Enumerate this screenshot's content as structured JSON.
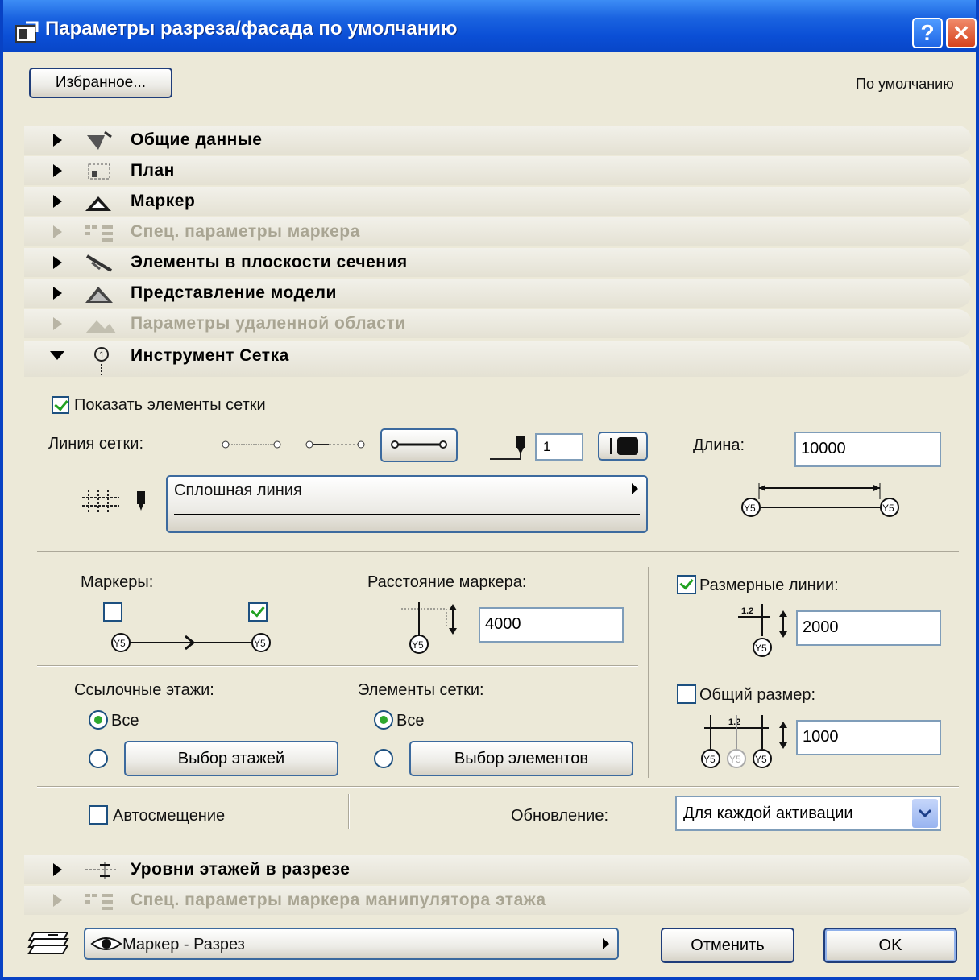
{
  "window": {
    "title": "Параметры разреза/фасада по умолчанию",
    "help_button": "?",
    "close_button": "✕"
  },
  "header": {
    "favorites_label": "Избранное...",
    "default_label": "По умолчанию"
  },
  "sections_top": [
    {
      "label": "Общие данные",
      "enabled": true,
      "icon": "general-icon"
    },
    {
      "label": "План",
      "enabled": true,
      "icon": "plan-icon"
    },
    {
      "label": "Маркер",
      "enabled": true,
      "icon": "marker-icon"
    },
    {
      "label": "Спец. параметры маркера",
      "enabled": false,
      "icon": "custom-params-icon"
    },
    {
      "label": "Элементы в плоскости сечения",
      "enabled": true,
      "icon": "cut-elements-icon"
    },
    {
      "label": "Представление модели",
      "enabled": true,
      "icon": "model-display-icon"
    },
    {
      "label": "Параметры удаленной области",
      "enabled": false,
      "icon": "distant-area-icon"
    }
  ],
  "grid_tool": {
    "section_label": "Инструмент Сетка",
    "show_grid_label": "Показать элементы сетки",
    "show_grid_checked": true,
    "grid_line_label": "Линия сетки:",
    "pen_value": "1",
    "length_label": "Длина:",
    "length_value": "10000",
    "line_type_value": "Сплошная линия",
    "markers_label": "Маркеры:",
    "marker_start_checked": false,
    "marker_end_checked": true,
    "marker_distance_label": "Расстояние маркера:",
    "marker_distance_value": "4000",
    "dimension_lines_label": "Размерные линии:",
    "dimension_lines_checked": true,
    "dimension_lines_value": "2000",
    "overall_dim_label": "Общий размер:",
    "overall_dim_checked": false,
    "overall_dim_value": "1000",
    "ref_stories_label": "Ссылочные этажи:",
    "ref_all_label": "Все",
    "select_stories_label": "Выбор этажей",
    "grid_elements_label": "Элементы сетки:",
    "elements_all_label": "Все",
    "select_elements_label": "Выбор элементов",
    "auto_offset_label": "Автосмещение",
    "auto_offset_checked": false,
    "update_label": "Обновление:",
    "update_value": "Для каждой активации",
    "marker_glyph": "Y5",
    "dim_glyph": "1.2"
  },
  "sections_bottom": [
    {
      "label": "Уровни этажей в разрезе",
      "enabled": true,
      "icon": "story-levels-icon"
    },
    {
      "label": "Спец. параметры маркера манипулятора этажа",
      "enabled": false,
      "icon": "custom-params-icon"
    }
  ],
  "footer": {
    "layer_value": "Маркер - Разрез",
    "cancel_label": "Отменить",
    "ok_label": "OK"
  }
}
